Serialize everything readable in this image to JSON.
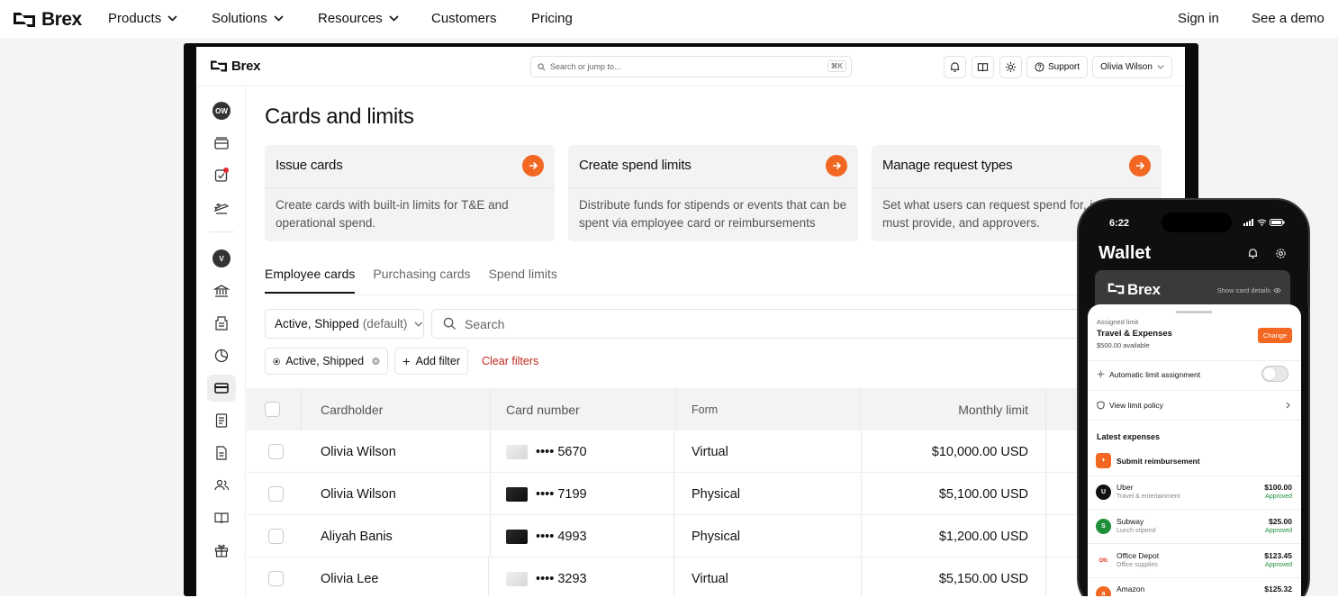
{
  "site_nav": {
    "brand": "Brex",
    "items": [
      {
        "label": "Products",
        "has_menu": true
      },
      {
        "label": "Solutions",
        "has_menu": true
      },
      {
        "label": "Resources",
        "has_menu": true
      },
      {
        "label": "Customers",
        "has_menu": false
      },
      {
        "label": "Pricing",
        "has_menu": false
      }
    ],
    "sign_in": "Sign in",
    "demo": "See a demo"
  },
  "app": {
    "brand": "Brex",
    "search_placeholder": "Search or jump to...",
    "search_shortcut": "⌘K",
    "support_label": "Support",
    "user_name": "Olivia Wilson",
    "sidebar": {
      "avatar_top": "OW",
      "avatar_entity": "V",
      "icons": [
        "wallet-icon",
        "tasks-icon",
        "travel-icon",
        "bank-icon",
        "receipt-icon",
        "chart-icon",
        "card-icon",
        "document-icon",
        "report-icon",
        "team-icon",
        "book-icon",
        "gift-icon"
      ],
      "active": "card-icon"
    },
    "page_title": "Cards and limits",
    "feature_cards": [
      {
        "title": "Issue cards",
        "description": "Create cards with built-in limits for T&E and operational spend."
      },
      {
        "title": "Create spend limits",
        "description": "Distribute funds for stipends or events that can be spent via employee card or reimbursements"
      },
      {
        "title": "Manage request types",
        "description": "Set what users can request spend for, info they must provide, and approvers."
      }
    ],
    "tabs": [
      "Employee cards",
      "Purchasing cards",
      "Spend limits"
    ],
    "active_tab": "Employee cards",
    "filter_select": {
      "value": "Active, Shipped",
      "suffix": "(default)"
    },
    "table_search_placeholder": "Search",
    "chips": {
      "active_filter": "Active, Shipped",
      "add_filter": "Add filter"
    },
    "clear_filters": "Clear filters",
    "table": {
      "columns": [
        "Cardholder",
        "Card number",
        "Form",
        "Monthly limit"
      ],
      "rows": [
        {
          "cardholder": "Olivia Wilson",
          "card_number": "•••• 5670",
          "form": "Virtual",
          "limit": "$10,000.00 USD"
        },
        {
          "cardholder": "Olivia Wilson",
          "card_number": "•••• 7199",
          "form": "Physical",
          "limit": "$5,100.00 USD"
        },
        {
          "cardholder": "Aliyah Banis",
          "card_number": "•••• 4993",
          "form": "Physical",
          "limit": "$1,200.00 USD"
        },
        {
          "cardholder": "Olivia Lee",
          "card_number": "•••• 3293",
          "form": "Virtual",
          "limit": "$5,150.00 USD"
        }
      ]
    }
  },
  "phone": {
    "time": "6:22",
    "title": "Wallet",
    "card_brand": "Brex",
    "show_details": "Show card details",
    "assigned_label": "Assigned limit",
    "limit_name": "Travel & Expenses",
    "available": "$500.00 available",
    "change": "Change",
    "auto_assign": "Automatic limit assignment",
    "view_policy": "View limit policy",
    "latest_expenses": "Latest expenses",
    "submit_reimbursement": "Submit reimbursement",
    "expenses": [
      {
        "merchant": "Uber",
        "category": "Travel & entertainment",
        "amount": "$100.00",
        "status": "Approved",
        "color": "#111111"
      },
      {
        "merchant": "Subway",
        "category": "Lunch stipend",
        "amount": "$25.00",
        "status": "Approved",
        "color": "#1f8f3a"
      },
      {
        "merchant": "Office Depot",
        "category": "Office supplies",
        "amount": "$123.45",
        "status": "Approved",
        "color": "#e02a1c"
      },
      {
        "merchant": "Amazon",
        "category": "",
        "amount": "$125.32",
        "status": "",
        "color": "#f26722"
      }
    ]
  },
  "colors": {
    "accent": "#f26722",
    "danger": "#c0281e",
    "approved": "#1a8f3a"
  }
}
